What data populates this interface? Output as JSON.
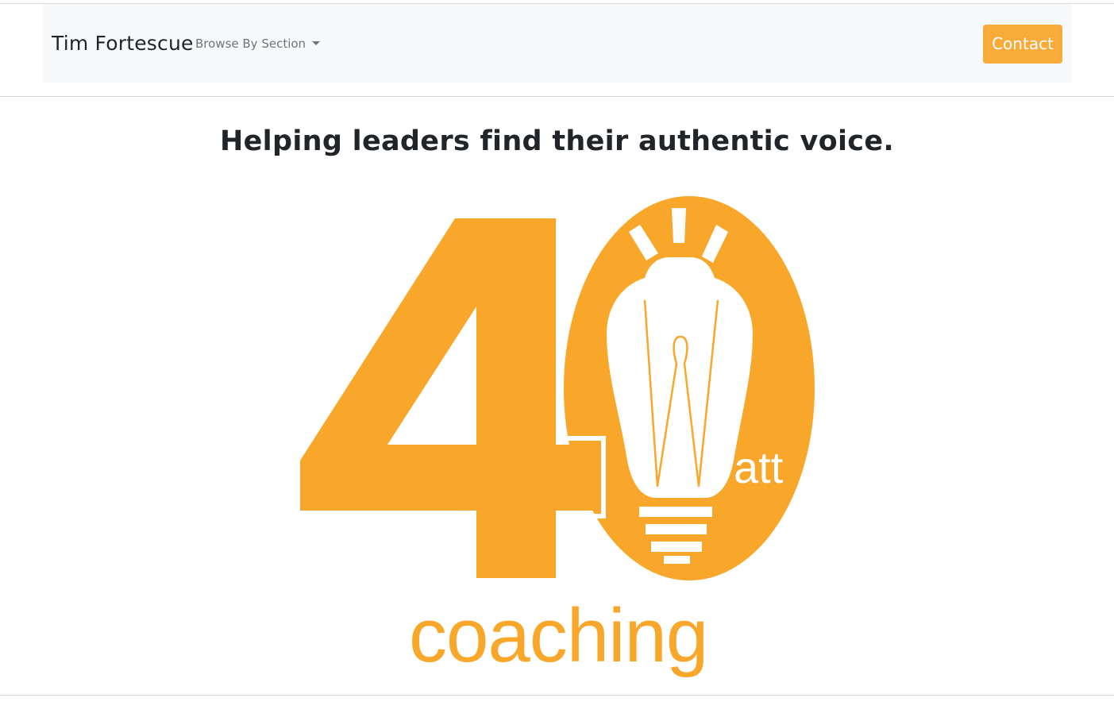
{
  "navbar": {
    "brand": "Tim Fortescue",
    "browse_label": "Browse By Section",
    "contact_label": "Contact"
  },
  "main": {
    "headline": "Helping leaders find their authentic voice.",
    "logo": {
      "number": "40",
      "watt_suffix": "att",
      "tagline": "coaching"
    }
  },
  "colors": {
    "accent": "#f9a72b",
    "button": "#f9ab3a",
    "navbar_bg": "#f8f9fa",
    "text": "#212529",
    "muted": "#6c757d"
  },
  "icons": {
    "dropdown_caret": "chevron-down-icon",
    "logo_bulb": "lightbulb-icon"
  }
}
